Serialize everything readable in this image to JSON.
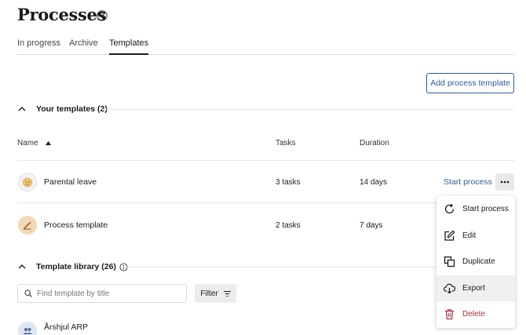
{
  "page": {
    "title": "Processes"
  },
  "tabs": [
    {
      "label": "In progress",
      "active": false
    },
    {
      "label": "Archive",
      "active": false
    },
    {
      "label": "Templates",
      "active": true
    }
  ],
  "actions": {
    "add_template_label": "Add process template"
  },
  "your_templates": {
    "header": "Your templates (2)",
    "columns": {
      "name": "Name",
      "tasks": "Tasks",
      "duration": "Duration"
    },
    "rows": [
      {
        "name": "Parental leave",
        "tasks": "3 tasks",
        "duration": "14 days",
        "avatar_icon": "baby-face-icon",
        "avatar_color": "#f2f2f2"
      },
      {
        "name": "Process template",
        "tasks": "2 tasks",
        "duration": "7 days",
        "avatar_icon": "pen-icon",
        "avatar_color": "#f1d9b5"
      }
    ],
    "start_process_label": "Start process"
  },
  "template_library": {
    "header": "Template library (26)",
    "search_placeholder": "Find template by title",
    "filter_label": "Filter",
    "items": [
      {
        "name": "Årshjul ARP",
        "avatar_icon": "people-icon",
        "avatar_color": "#dde6f3"
      }
    ]
  },
  "context_menu": {
    "items": [
      {
        "label": "Start process",
        "icon": "restart-icon"
      },
      {
        "label": "Edit",
        "icon": "edit-icon"
      },
      {
        "label": "Duplicate",
        "icon": "duplicate-icon"
      },
      {
        "label": "Export",
        "icon": "export-icon",
        "hovered": true
      },
      {
        "label": "Delete",
        "icon": "trash-icon",
        "danger": true
      }
    ]
  },
  "colors": {
    "accent": "#2d5b9a",
    "danger": "#a8323f",
    "text": "#1a1a1a",
    "border": "#e6e6e6"
  }
}
